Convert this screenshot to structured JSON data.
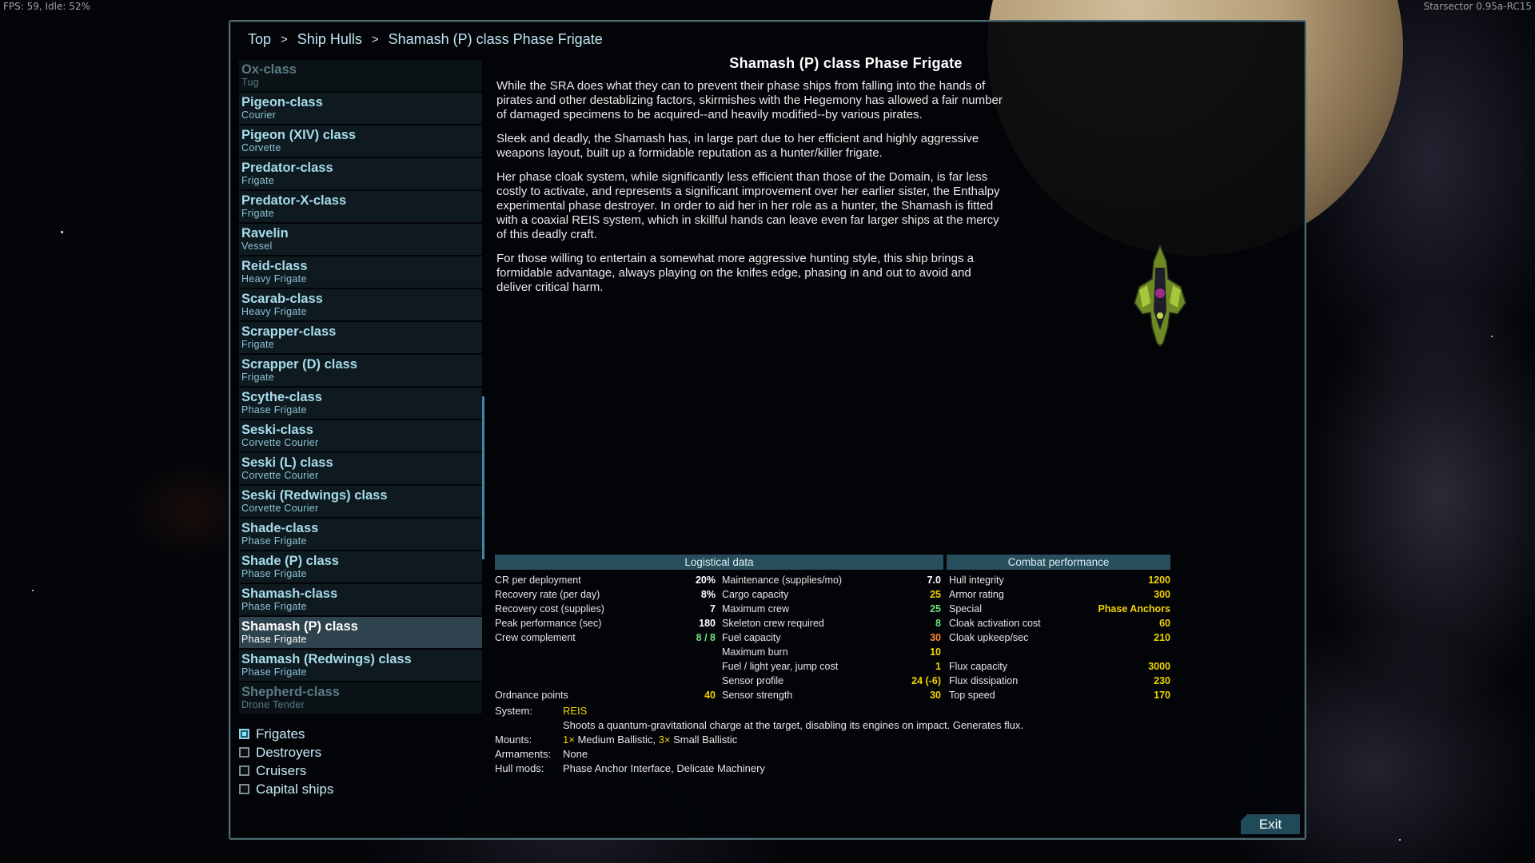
{
  "hud": {
    "fps": "FPS: 59, Idle: 52%",
    "version": "Starsector 0.95a-RC15"
  },
  "breadcrumb": {
    "items": [
      "Top",
      "Ship Hulls",
      "Shamash (P) class Phase Frigate"
    ]
  },
  "list": {
    "items": [
      {
        "name": "Ox-class",
        "sub": "Tug",
        "state": "dim"
      },
      {
        "name": "Pigeon-class",
        "sub": "Courier"
      },
      {
        "name": "Pigeon (XIV) class",
        "sub": "Corvette"
      },
      {
        "name": "Predator-class",
        "sub": "Frigate"
      },
      {
        "name": "Predator-X-class",
        "sub": "Frigate"
      },
      {
        "name": "Ravelin",
        "sub": "Vessel"
      },
      {
        "name": "Reid-class",
        "sub": "Heavy Frigate"
      },
      {
        "name": "Scarab-class",
        "sub": "Heavy Frigate"
      },
      {
        "name": "Scrapper-class",
        "sub": "Frigate"
      },
      {
        "name": "Scrapper (D) class",
        "sub": "Frigate"
      },
      {
        "name": "Scythe-class",
        "sub": "Phase Frigate"
      },
      {
        "name": "Seski-class",
        "sub": "Corvette Courier"
      },
      {
        "name": "Seski (L) class",
        "sub": "Corvette Courier"
      },
      {
        "name": "Seski (Redwings) class",
        "sub": "Corvette Courier"
      },
      {
        "name": "Shade-class",
        "sub": "Phase Frigate"
      },
      {
        "name": "Shade (P) class",
        "sub": "Phase Frigate"
      },
      {
        "name": "Shamash-class",
        "sub": "Phase Frigate"
      },
      {
        "name": "Shamash (P) class",
        "sub": "Phase Frigate",
        "state": "selected"
      },
      {
        "name": "Shamash (Redwings) class",
        "sub": "Phase Frigate"
      },
      {
        "name": "Shepherd-class",
        "sub": "Drone Tender",
        "state": "dim"
      }
    ]
  },
  "filters": [
    {
      "label": "Frigates",
      "checked": true
    },
    {
      "label": "Destroyers",
      "checked": false
    },
    {
      "label": "Cruisers",
      "checked": false
    },
    {
      "label": "Capital ships",
      "checked": false
    }
  ],
  "detail": {
    "title": "Shamash (P) class Phase Frigate",
    "paragraphs": [
      "While the SRA does what they can to prevent their phase ships from falling into the hands of pirates and other destablizing factors, skirmishes with the Hegemony has allowed a fair number of damaged specimens to be acquired--and heavily modified--by various pirates.",
      "Sleek and deadly, the Shamash has, in large part due to her efficient and highly aggressive weapons layout, built up a formidable reputation as a hunter/killer frigate.",
      "Her phase cloak system, while significantly less efficient than those of the Domain, is far less costly to activate, and represents a significant improvement over her earlier sister, the Enthalpy experimental phase destroyer. In order to aid her in her role as a hunter, the Shamash is fitted with a coaxial REIS system, which in skillful hands can leave even far larger ships at the mercy of this deadly craft.",
      "For those willing to entertain a somewhat more aggressive hunting style, this ship brings a formidable advantage, always playing on the knifes edge, phasing in and out to avoid and deliver critical harm."
    ],
    "ship_image": "ship-sprite"
  },
  "stats": {
    "headers": {
      "logistical": "Logistical data",
      "combat": "Combat performance"
    },
    "col1": [
      {
        "k": "CR per deployment",
        "v": "20%",
        "c": "white"
      },
      {
        "k": "Recovery rate (per day)",
        "v": "8%",
        "c": "white"
      },
      {
        "k": "Recovery cost (supplies)",
        "v": "7",
        "c": "white"
      },
      {
        "k": "Peak performance (sec)",
        "v": "180",
        "c": "white"
      },
      {
        "k": "Crew complement",
        "v": "8 / 8",
        "c": "green"
      }
    ],
    "col1_bottom": {
      "k": "Ordnance points",
      "v": "40",
      "c": "yellow"
    },
    "col2": [
      {
        "k": "Maintenance (supplies/mo)",
        "v": "7.0",
        "c": "white"
      },
      {
        "k": "Cargo capacity",
        "v": "25",
        "c": "yellow"
      },
      {
        "k": "Maximum crew",
        "v": "25",
        "c": "green"
      },
      {
        "k": "Skeleton crew required",
        "v": "8",
        "c": "green"
      },
      {
        "k": "Fuel capacity",
        "v": "30",
        "c": "orange"
      },
      {
        "k": "Maximum burn",
        "v": "10",
        "c": "yellow"
      },
      {
        "k": "Fuel / light year, jump cost",
        "v": "1",
        "c": "yellow"
      },
      {
        "k": "Sensor profile",
        "v": "24 (-6)",
        "c": "yellow"
      },
      {
        "k": "Sensor strength",
        "v": "30",
        "c": "yellow"
      }
    ],
    "col3": [
      {
        "k": "Hull integrity",
        "v": "1200",
        "c": "yellow"
      },
      {
        "k": "Armor rating",
        "v": "300",
        "c": "yellow"
      },
      {
        "k": "Special",
        "v": "Phase Anchors",
        "c": "yellow"
      },
      {
        "k": "Cloak activation cost",
        "v": "60",
        "c": "yellow"
      },
      {
        "k": "Cloak upkeep/sec",
        "v": "210",
        "c": "yellow"
      },
      {
        "k": "",
        "v": "",
        "c": "white"
      },
      {
        "k": "Flux capacity",
        "v": "3000",
        "c": "yellow"
      },
      {
        "k": "Flux dissipation",
        "v": "230",
        "c": "yellow"
      },
      {
        "k": "Top speed",
        "v": "170",
        "c": "yellow"
      }
    ]
  },
  "system": {
    "system_label": "System:",
    "system_name": "REIS",
    "system_desc": "Shoots a quantum-gravitational charge at the target, disabling its engines on impact. Generates flux.",
    "mounts_label": "Mounts:",
    "mounts_a_count": "1×",
    "mounts_a_type": "Medium Ballistic,",
    "mounts_b_count": "3×",
    "mounts_b_type": "Small Ballistic",
    "armaments_label": "Armaments:",
    "armaments_value": "None",
    "hullmods_label": "Hull mods:",
    "hullmods_value": "Phase Anchor Interface, Delicate Machinery"
  },
  "exit_label": "Exit",
  "colors": {
    "accent": "#a7dcea",
    "header_bg": "#284d5b",
    "highlight": "#f2d300",
    "good": "#6fe07e",
    "warn": "#ff8a3a"
  }
}
